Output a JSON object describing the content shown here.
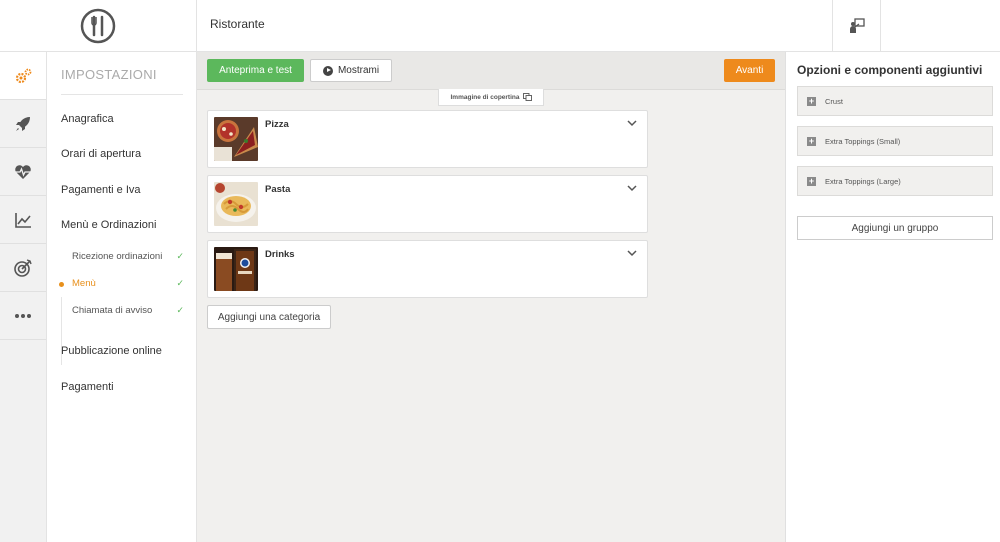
{
  "header": {
    "title": "Ristorante",
    "logo_icon": "fork-knife-logo-icon",
    "action_icon": "presenter-icon"
  },
  "rail": {
    "items": [
      {
        "icon": "gears-icon",
        "active": true
      },
      {
        "icon": "rocket-icon"
      },
      {
        "icon": "heartbeat-icon"
      },
      {
        "icon": "line-chart-icon"
      },
      {
        "icon": "target-icon"
      },
      {
        "icon": "more-dots-icon"
      }
    ]
  },
  "nav": {
    "title": "IMPOSTAZIONI",
    "items": [
      "Anagrafica",
      "Orari di apertura",
      "Pagamenti e Iva",
      "Menù e Ordinazioni",
      "Pubblicazione online",
      "Pagamenti"
    ],
    "sub_items": [
      {
        "label": "Ricezione ordinazioni",
        "checked": true
      },
      {
        "label": "Menù",
        "checked": true,
        "active": true
      },
      {
        "label": "Chiamata di avviso",
        "checked": true
      }
    ],
    "check_mark": "✓"
  },
  "toolbar": {
    "preview_label": "Anteprima e test",
    "show_label": "Mostrami",
    "next_label": "Avanti"
  },
  "cover": {
    "label": "Immagine di copertina"
  },
  "categories": [
    {
      "name": "Pizza"
    },
    {
      "name": "Pasta"
    },
    {
      "name": "Drinks"
    }
  ],
  "add_category_label": "Aggiungi una categoria",
  "options": {
    "title": "Opzioni e componenti aggiuntivi",
    "groups": [
      "Crust",
      "Extra Toppings (Small)",
      "Extra Toppings (Large)"
    ],
    "add_group_label": "Aggiungi un gruppo",
    "plus_symbol": "+"
  },
  "colors": {
    "accent_orange": "#ee8a1c",
    "accent_green": "#5cb85c"
  }
}
